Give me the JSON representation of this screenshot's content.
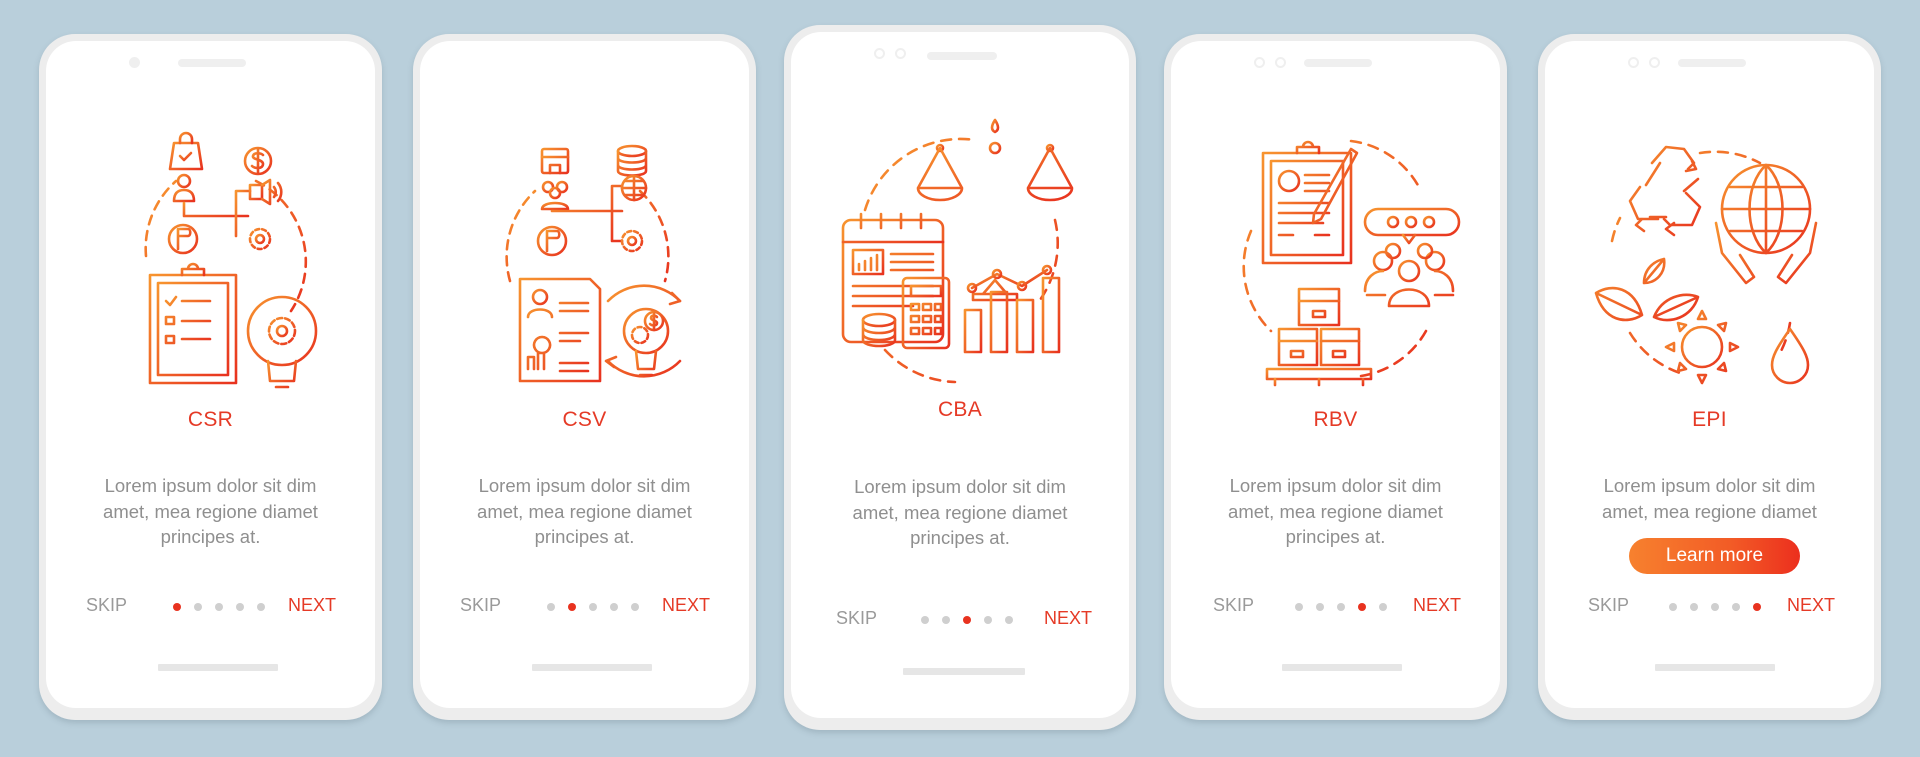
{
  "theme": {
    "background": "#b9cfdb",
    "accent": "#e53a26",
    "gradient_start": "#f7812e",
    "gradient_end": "#e8321f",
    "text_muted": "#8f8f8f",
    "dot_inactive": "#cfcfcf"
  },
  "screens": [
    {
      "title": "CSR",
      "illustration": "corporate-social-responsibility-illustration",
      "description": [
        "Lorem ipsum dolor sit dim",
        "amet, mea regione diamet",
        "principes at."
      ],
      "skip_label": "SKIP",
      "next_label": "NEXT",
      "active_page": 1,
      "total_pages": 5
    },
    {
      "title": "CSV",
      "illustration": "creating-shared-value-illustration",
      "description": [
        "Lorem ipsum dolor sit dim",
        "amet, mea regione diamet",
        "principes at."
      ],
      "skip_label": "SKIP",
      "next_label": "NEXT",
      "active_page": 2,
      "total_pages": 5
    },
    {
      "title": "CBA",
      "illustration": "cost-benefit-analysis-illustration",
      "description": [
        "Lorem ipsum dolor sit dim",
        "amet, mea regione diamet",
        "principes at."
      ],
      "skip_label": "SKIP",
      "next_label": "NEXT",
      "active_page": 3,
      "total_pages": 5
    },
    {
      "title": "RBV",
      "illustration": "resource-based-view-illustration",
      "description": [
        "Lorem ipsum dolor sit dim",
        "amet, mea regione diamet",
        "principes at."
      ],
      "skip_label": "SKIP",
      "next_label": "NEXT",
      "active_page": 4,
      "total_pages": 5
    },
    {
      "title": "EPI",
      "illustration": "environmental-performance-index-illustration",
      "description": [
        "Lorem ipsum dolor sit dim",
        "amet, mea regione diamet"
      ],
      "cta_label": "Learn more",
      "skip_label": "SKIP",
      "next_label": "NEXT",
      "active_page": 5,
      "total_pages": 5
    }
  ]
}
